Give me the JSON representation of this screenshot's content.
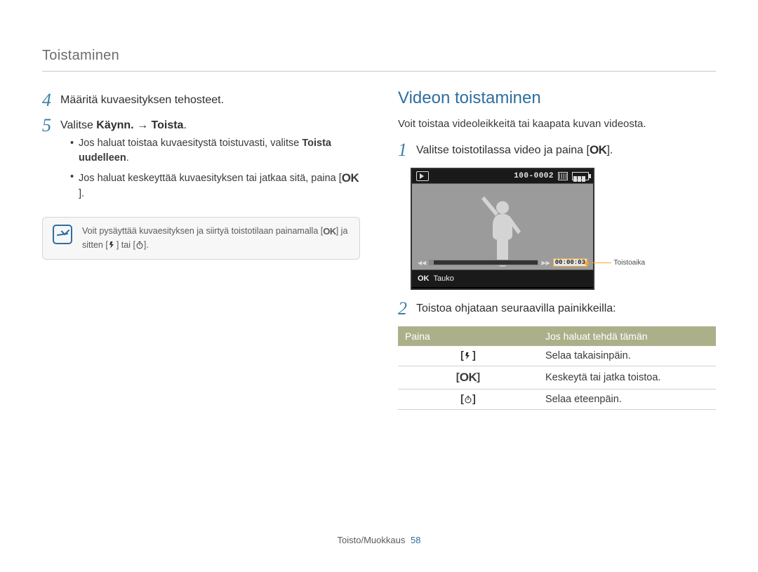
{
  "header": {
    "section": "Toistaminen"
  },
  "left": {
    "step4": {
      "num": "4",
      "text": "Määritä kuvaesityksen tehosteet."
    },
    "step5": {
      "num": "5",
      "text_pre": "Valitse ",
      "text_bold": "Käynn.",
      "text_arrow": " → ",
      "text_bold2": "Toista",
      "text_post": ".",
      "bullets": [
        {
          "pre": "Jos haluat toistaa kuvaesitystä toistuvasti, valitse ",
          "bold": "Toista uudelleen",
          "post": "."
        },
        {
          "pre": "Jos haluat keskeyttää kuvaesityksen tai jatkaa sitä, paina [",
          "ok": "OK",
          "post": "]."
        }
      ]
    },
    "note": {
      "pre": "Voit pysäyttää kuvaesityksen ja siirtyä toistotilaan painamalla [",
      "ok": "OK",
      "mid": "] ja sitten [",
      "or": "] tai [",
      "end": "]."
    }
  },
  "right": {
    "title": "Videon toistaminen",
    "lead": "Voit toistaa videoleikkeitä tai kaapata kuvan videosta.",
    "step1": {
      "num": "1",
      "pre": "Valitse toistotilassa video ja paina [",
      "ok": "OK",
      "post": "]."
    },
    "lcd": {
      "file": "100-0002",
      "time": "00:00:03",
      "pause_label": "Tauko",
      "callout": "Toistoaika",
      "progress_fill_pct": 4
    },
    "step2": {
      "num": "2",
      "text": "Toistoa ohjataan seuraavilla painikkeilla:"
    },
    "table": {
      "head": {
        "col1": "Paina",
        "col2": "Jos haluat tehdä tämän"
      },
      "rows": [
        {
          "icon": "flash",
          "action": "Selaa takaisinpäin."
        },
        {
          "icon": "ok",
          "action": "Keskeytä tai jatka toistoa."
        },
        {
          "icon": "timer",
          "action": "Selaa eteenpäin."
        }
      ]
    }
  },
  "footer": {
    "label": "Toisto/Muokkaus",
    "page": "58"
  }
}
